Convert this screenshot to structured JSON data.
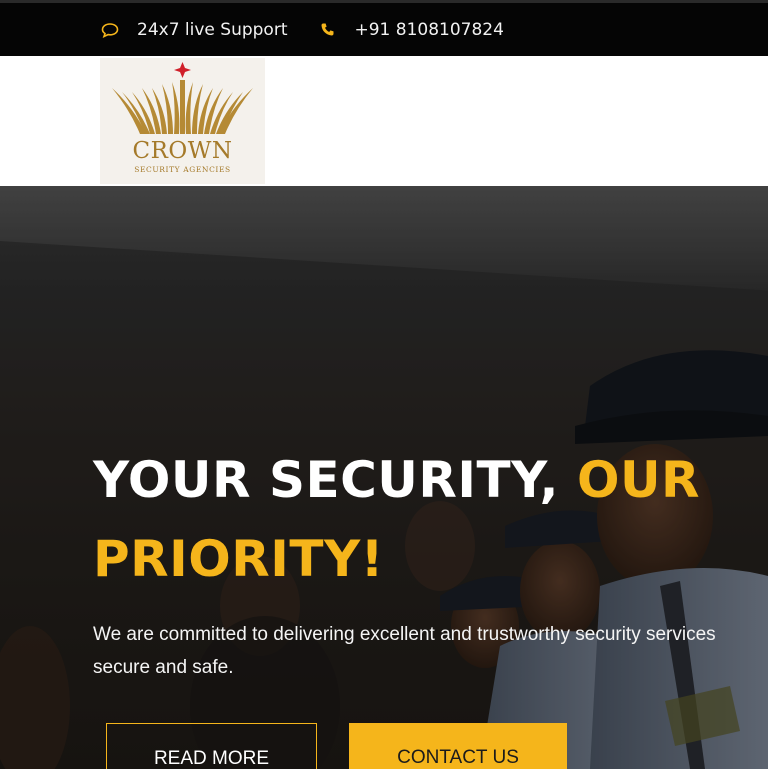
{
  "topbar": {
    "support_text": "24x7 live Support",
    "phone_text": "+91 8108107824",
    "icons": [
      "chat-bubble-icon",
      "phone-icon"
    ],
    "icon_color": "#f5b51b"
  },
  "logo": {
    "name": "CROWN",
    "subtitle": "SECURITY AGENCIES",
    "color": "#a57a2a",
    "star_color": "#d0202a"
  },
  "hero": {
    "title_white": "YOUR SECURITY, ",
    "title_accent": "OUR PRIORITY!",
    "description_line1": "We are committed to delivering excellent and trustworthy security services",
    "description_line2": "secure and safe.",
    "read_more_label": "READ MORE",
    "contact_label": "CONTACT US",
    "accent_color": "#f5b51b"
  }
}
